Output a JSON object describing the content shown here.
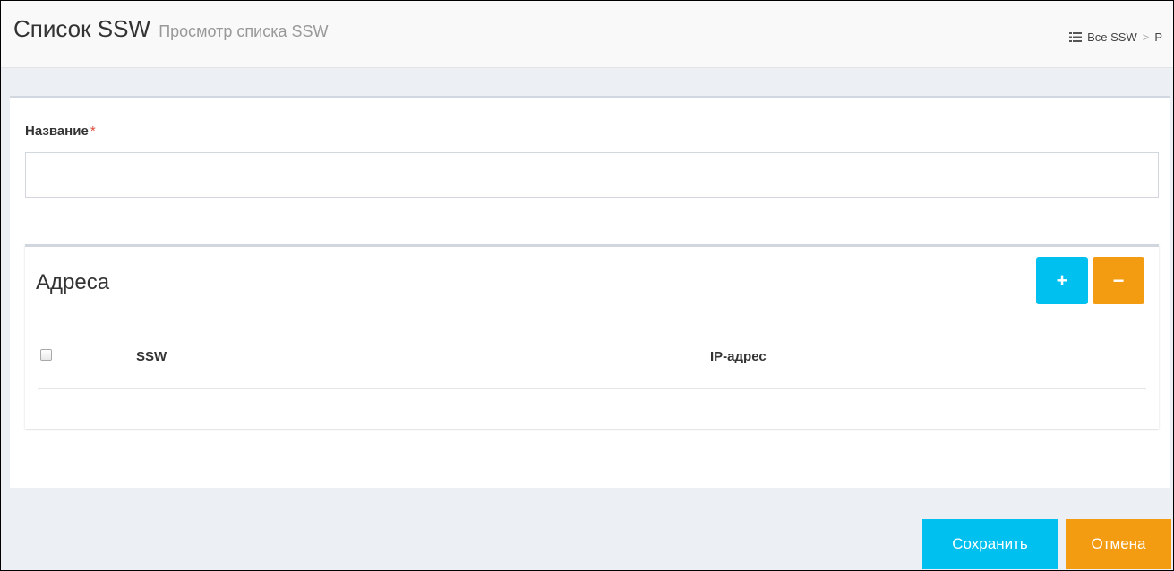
{
  "header": {
    "title": "Список SSW",
    "subtitle": "Просмотр списка SSW",
    "breadcrumb": [
      {
        "icon": "list-icon",
        "label": "Все SSW"
      },
      {
        "label": "Р"
      }
    ]
  },
  "form": {
    "name_label": "Название",
    "required_mark": "*",
    "name_value": ""
  },
  "addresses": {
    "title": "Адреса",
    "add_label": "+",
    "remove_label": "−",
    "columns": [
      "SSW",
      "IP-адрес"
    ],
    "rows": []
  },
  "actions": {
    "save_label": "Сохранить",
    "cancel_label": "Отмена"
  },
  "colors": {
    "info": "#00c0ef",
    "warning": "#f39c12",
    "danger": "#dd4b39"
  }
}
